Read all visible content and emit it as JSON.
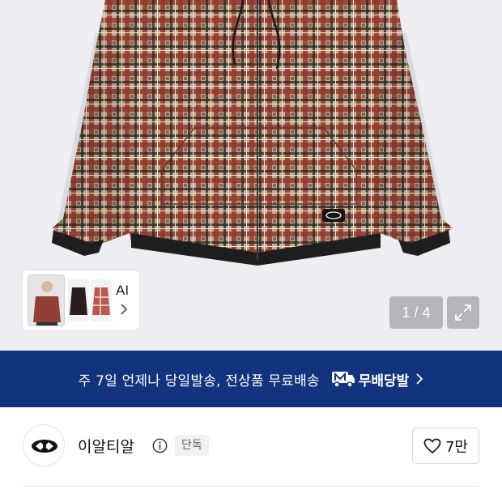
{
  "product_image": {
    "counter": "1 / 4",
    "ai_label": "AI"
  },
  "shipping_banner": {
    "text": "주 7일 언제나 당일발송, 전상품 무료배송",
    "badge_label": "무배당발",
    "background": "#12337d"
  },
  "brand": {
    "name": "이알티알",
    "exclusive_badge": "단독",
    "like_count": "7만"
  },
  "icons": [
    "expand-icon",
    "chevron-right-icon",
    "m-truck-icon",
    "info-icon",
    "heart-icon",
    "brand-logo-icon"
  ]
}
